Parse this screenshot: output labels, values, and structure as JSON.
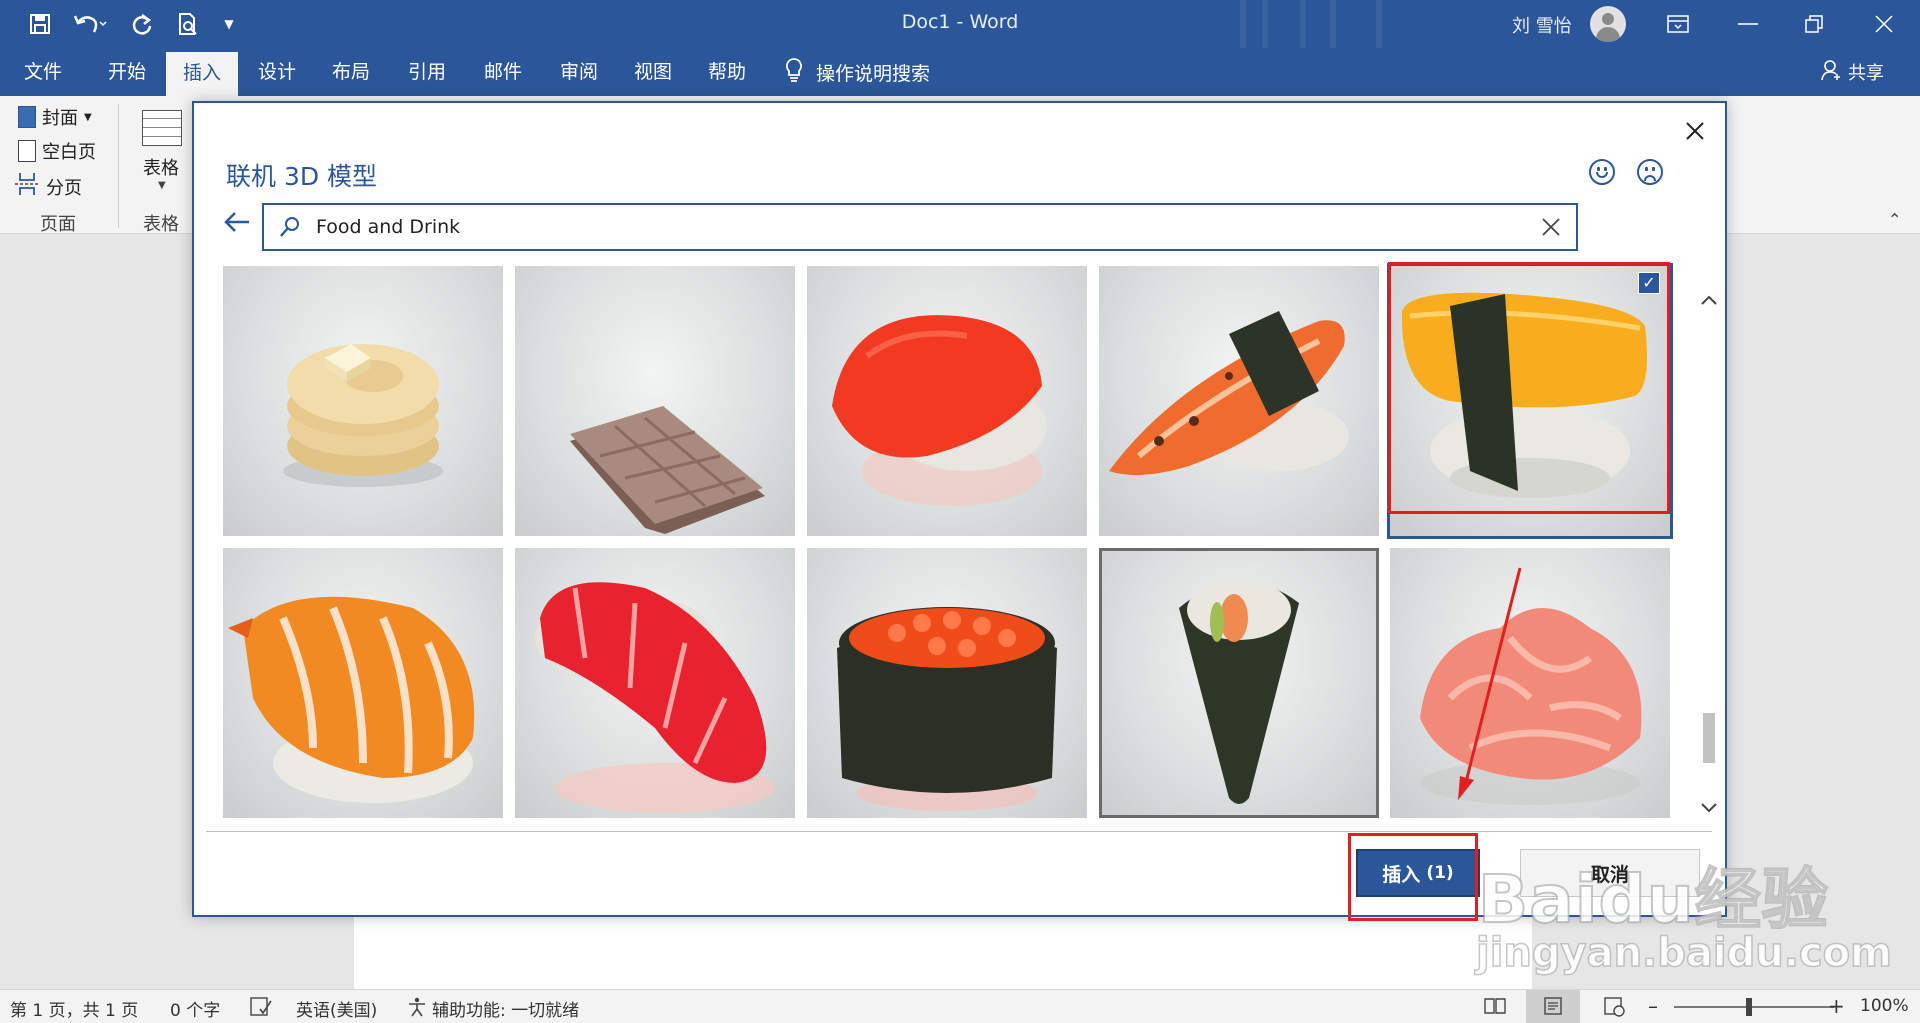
{
  "titlebar": {
    "doc_title": "Doc1  -  Word",
    "user_name": "刘 雪怡",
    "qat_icons": [
      "save-icon",
      "undo-icon",
      "redo-icon",
      "print-preview-icon",
      "customize-icon"
    ],
    "window_buttons": [
      "ribbon-display-icon",
      "minimize-icon",
      "restore-icon",
      "close-icon"
    ]
  },
  "tabs": [
    "文件",
    "开始",
    "插入",
    "设计",
    "布局",
    "引用",
    "邮件",
    "审阅",
    "视图",
    "帮助"
  ],
  "active_tab": "插入",
  "tell_me": "操作说明搜索",
  "share": "共享",
  "ribbon": {
    "cover_page": "封面",
    "blank_page": "空白页",
    "page_break": "分页",
    "pages_group": "页面",
    "table_label": "表格",
    "table_group": "表格"
  },
  "dialog": {
    "title": "联机 3D 模型",
    "search_value": "Food and Drink",
    "insert_label": "插入",
    "insert_count": "(1)",
    "cancel_label": "取消",
    "models": [
      "pancakes",
      "chocolate",
      "salmon-nigiri",
      "eel-nigiri",
      "tamago-nigiri",
      "shrimp-nigiri",
      "tuna-nigiri",
      "ikura-gunkan",
      "temaki",
      "pickled-ginger"
    ],
    "selected_index": 4,
    "selected_check": "✓"
  },
  "statusbar": {
    "page_info": "第 1 页，共 1 页",
    "word_count": "0 个字",
    "language": "英语(美国)",
    "accessibility": "辅助功能: 一切就绪",
    "zoom": "100%"
  },
  "watermark": {
    "main": "Baidu经验",
    "sub": "jingyan.baidu.com"
  },
  "colors": {
    "accent": "#2b579a",
    "highlight": "#e02020"
  }
}
